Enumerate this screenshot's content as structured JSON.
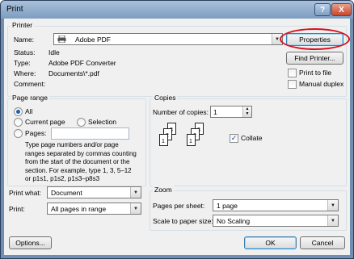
{
  "window": {
    "title": "Print",
    "help_glyph": "?",
    "close_glyph": "X"
  },
  "printer": {
    "group_title": "Printer",
    "name_label": "Name:",
    "name_value": "Adobe PDF",
    "status_label": "Status:",
    "status_value": "Idle",
    "type_label": "Type:",
    "type_value": "Adobe PDF Converter",
    "where_label": "Where:",
    "where_value": "Documents\\*.pdf",
    "comment_label": "Comment:",
    "comment_value": "",
    "properties_button": "Properties",
    "find_printer_button": "Find Printer...",
    "print_to_file_label": "Print to file",
    "print_to_file_checked": false,
    "manual_duplex_label": "Manual duplex",
    "manual_duplex_checked": false
  },
  "page_range": {
    "group_title": "Page range",
    "all_label": "All",
    "current_page_label": "Current page",
    "selection_label": "Selection",
    "pages_label": "Pages:",
    "pages_value": "",
    "selected": "All",
    "help_text": [
      "Type page numbers and/or page",
      "ranges separated by commas counting",
      "from the start of the document or the",
      "section. For example, type 1, 3, 5–12",
      "or p1s1, p1s2, p1s3–p8s3"
    ]
  },
  "copies": {
    "group_title": "Copies",
    "number_label": "Number of copies:",
    "number_value": "1",
    "collate_label": "Collate",
    "collate_checked": true,
    "page_numbers": [
      "3",
      "2",
      "1"
    ]
  },
  "print_what": {
    "label": "Print what:",
    "value": "Document"
  },
  "print": {
    "label": "Print:",
    "value": "All pages in range"
  },
  "zoom": {
    "group_title": "Zoom",
    "pages_per_sheet_label": "Pages per sheet:",
    "pages_per_sheet_value": "1 page",
    "scale_label": "Scale to paper size:",
    "scale_value": "No Scaling"
  },
  "footer": {
    "options_button": "Options...",
    "ok_button": "OK",
    "cancel_button": "Cancel"
  },
  "colors": {
    "annotation_circle": "#d4101e",
    "accent": "#1b5fad"
  }
}
